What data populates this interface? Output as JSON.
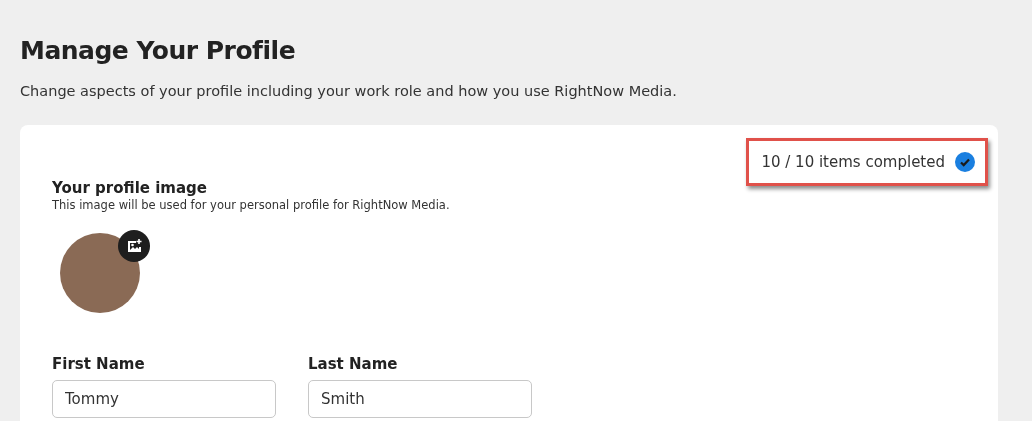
{
  "page": {
    "title": "Manage Your Profile",
    "subtitle": "Change aspects of your profile including your work role and how you use RightNow Media."
  },
  "progress": {
    "text": "10 / 10 items completed",
    "complete": true,
    "highlighted": true
  },
  "profile_image": {
    "heading": "Your profile image",
    "description": "This image will be used for your personal profile for RightNow Media."
  },
  "fields": [
    {
      "label": "First Name",
      "value": "Tommy"
    },
    {
      "label": "Last Name",
      "value": "Smith"
    }
  ]
}
